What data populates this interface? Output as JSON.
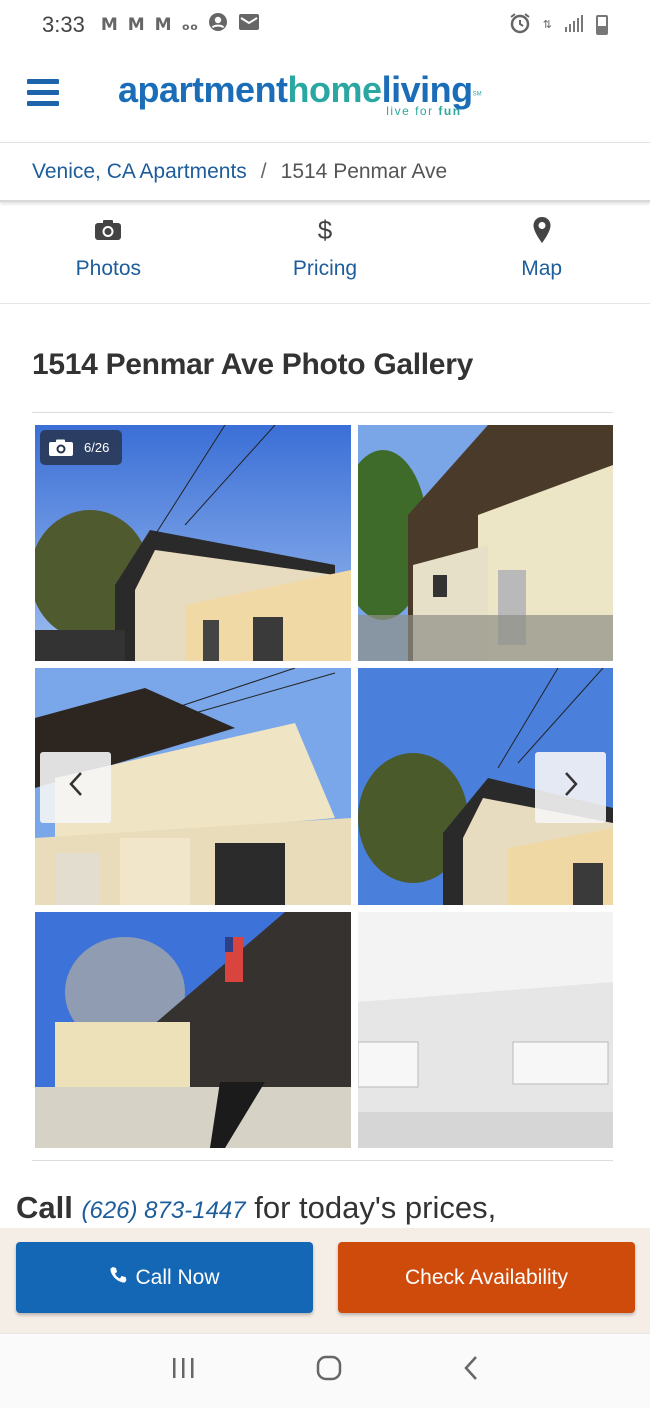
{
  "status_bar": {
    "time": "3:33",
    "left_icons": [
      "gmail-icon",
      "gmail-icon",
      "gmail-icon",
      "voicemail-icon",
      "account-icon",
      "mail-icon"
    ],
    "right_icons": [
      "alarm-icon",
      "data-icon",
      "signal-icon",
      "battery-icon"
    ]
  },
  "header": {
    "logo_part1": "apartment",
    "logo_part2": "home",
    "logo_part3": "living",
    "tagline_prefix": "live for ",
    "tagline_bold": "fun",
    "sm": "SM"
  },
  "breadcrumb": {
    "parent": "Venice, CA Apartments",
    "separator": "/",
    "current": "1514 Penmar Ave"
  },
  "tabs": [
    {
      "label": "Photos",
      "icon": "camera-icon"
    },
    {
      "label": "Pricing",
      "icon": "dollar-icon"
    },
    {
      "label": "Map",
      "icon": "map-pin-icon"
    }
  ],
  "gallery": {
    "title": "1514 Penmar Ave Photo Gallery",
    "counter": "6/26"
  },
  "call_line": {
    "prefix": "Call",
    "phone": "(626) 873-1447",
    "suffix": "for today's prices,"
  },
  "cta": {
    "call_now": "Call Now",
    "check_availability": "Check Availability"
  },
  "colors": {
    "brand_blue": "#1467b4",
    "cta_orange": "#cf4b0b",
    "link_blue": "#1d5d9b"
  }
}
